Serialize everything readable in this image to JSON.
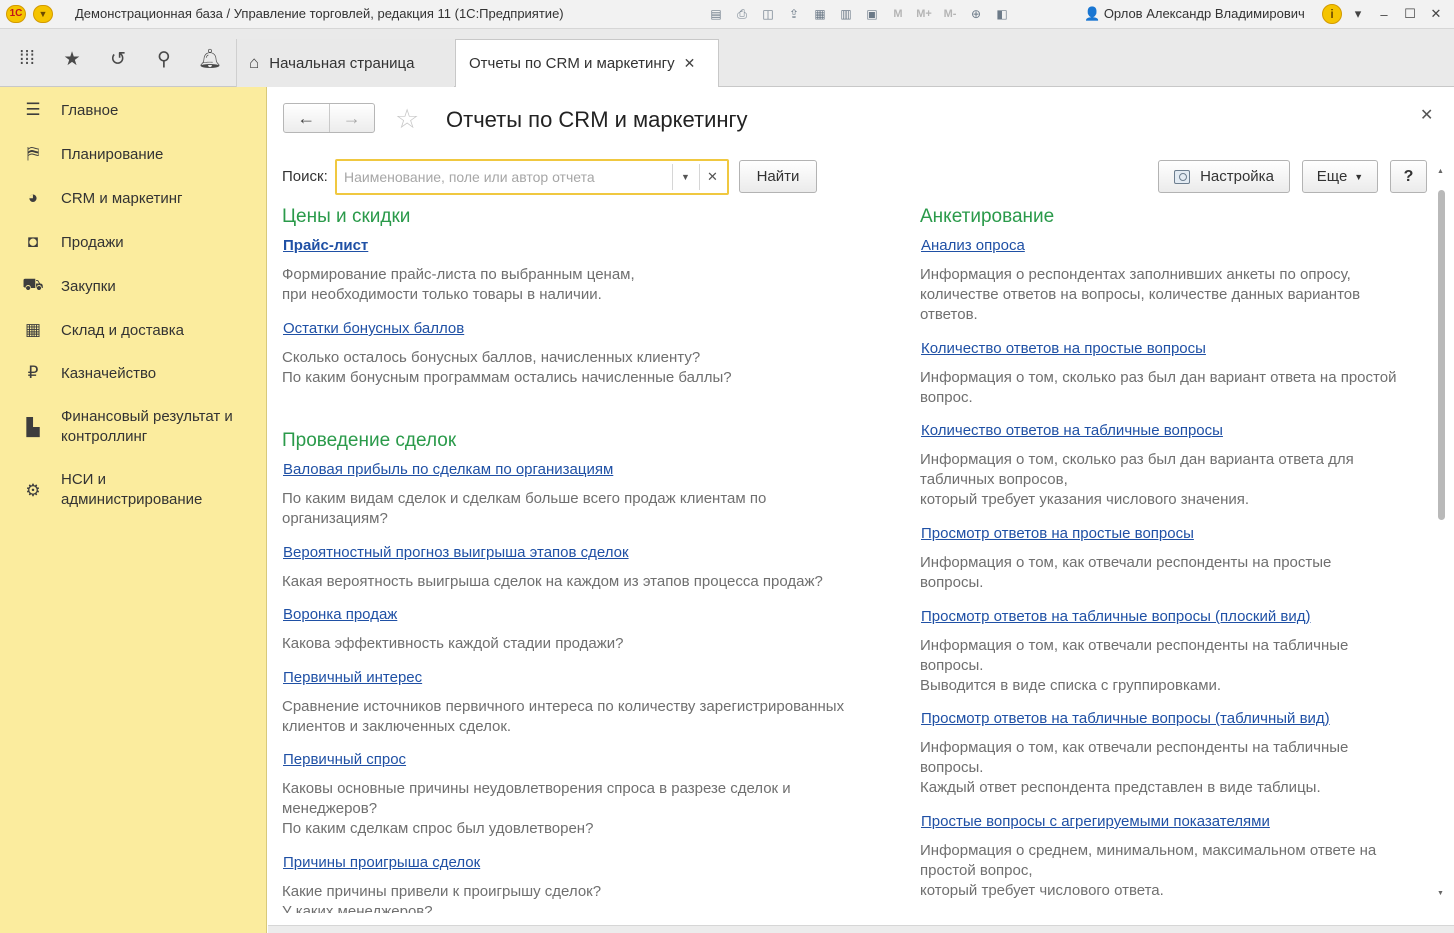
{
  "titlebar": {
    "logo": "1С",
    "title": "Демонстрационная база / Управление торговлей, редакция 11  (1С:Предприятие)",
    "user": "Орлов Александр Владимирович",
    "mem_labels": [
      "M",
      "M+",
      "M-"
    ]
  },
  "tabs": {
    "home": "Начальная страница",
    "active": "Отчеты по CRM и маркетингу"
  },
  "sidebar": {
    "items": [
      {
        "label": "Главное",
        "icon": "menu-icon"
      },
      {
        "label": "Планирование",
        "icon": "planning-icon"
      },
      {
        "label": "CRM и маркетинг",
        "icon": "pie-chart-icon"
      },
      {
        "label": "Продажи",
        "icon": "shopping-bag-icon"
      },
      {
        "label": "Закупки",
        "icon": "cart-icon"
      },
      {
        "label": "Склад и доставка",
        "icon": "warehouse-icon"
      },
      {
        "label": "Казначейство",
        "icon": "ruble-icon"
      },
      {
        "label": "Финансовый результат и контроллинг",
        "icon": "bar-chart-icon"
      },
      {
        "label": "НСИ и администрирование",
        "icon": "gear-icon"
      }
    ]
  },
  "page": {
    "title": "Отчеты по CRM и маркетингу",
    "search_label": "Поиск:",
    "search_placeholder": "Наименование, поле или автор отчета",
    "find_button": "Найти",
    "setup_button": "Настройка",
    "more_button": "Еще",
    "help_button": "?"
  },
  "left": {
    "sections": [
      {
        "title": "Цены и скидки",
        "reports": [
          {
            "name": "Прайс-лист",
            "desc": "Формирование прайс-листа по выбранным ценам,\nпри необходимости только товары в наличии."
          },
          {
            "name": "Остатки бонусных баллов",
            "desc": "Сколько осталось бонусных баллов, начисленных клиенту?\nПо каким бонусным программам остались начисленные баллы?"
          }
        ]
      },
      {
        "title": "Проведение сделок",
        "reports": [
          {
            "name": "Валовая прибыль по сделкам по организациям",
            "desc": "По каким видам сделок и сделкам больше всего продаж клиентам по\nорганизациям?"
          },
          {
            "name": "Вероятностный прогноз выигрыша этапов сделок",
            "desc": "Какая вероятность выигрыша сделок на каждом из этапов процесса продаж?"
          },
          {
            "name": "Воронка продаж",
            "desc": "Какова эффективность каждой стадии продажи?"
          },
          {
            "name": "Первичный интерес",
            "desc": "Сравнение источников первичного интереса по количеству зарегистрированных\nклиентов и заключенных сделок."
          },
          {
            "name": "Первичный спрос",
            "desc": "Каковы основные причины неудовлетворения спроса в разрезе сделок и\nменеджеров?\nПо каким сделкам спрос был удовлетворен?"
          },
          {
            "name": "Причины проигрыша сделок",
            "desc": "Какие причины привели к проигрышу сделок?\nУ каких менеджеров?"
          }
        ]
      }
    ]
  },
  "right": {
    "sections": [
      {
        "title": "Анкетирование",
        "reports": [
          {
            "name": "Анализ опроса",
            "desc": "Информация о респондентах заполнивших анкеты по опросу,\nколичестве ответов на вопросы, количестве данных вариантов\nответов."
          },
          {
            "name": "Количество ответов на простые вопросы",
            "desc": "Информация о том, сколько раз был дан вариант ответа на простой\nвопрос."
          },
          {
            "name": "Количество ответов на табличные вопросы",
            "desc": "Информация о том, сколько раз был дан варианта ответа для\nтабличных вопросов,\nкоторый требует указания числового значения."
          },
          {
            "name": "Просмотр ответов на простые вопросы",
            "desc": "Информация о том, как отвечали респонденты на простые\nвопросы."
          },
          {
            "name": "Просмотр ответов на табличные вопросы (плоский вид)",
            "desc": "Информация о том, как отвечали респонденты на табличные\nвопросы.\nВыводится в виде списка с группировками."
          },
          {
            "name": "Просмотр ответов на табличные вопросы (табличный вид)",
            "desc": "Информация о том, как  отвечали респонденты на табличные\nвопросы.\nКаждый ответ респондента представлен в виде таблицы."
          },
          {
            "name": "Простые вопросы с агрегируемыми показателями",
            "desc": "Информация о среднем, минимальном, максимальном ответе на\nпростой вопрос,\nкоторый требует числового ответа."
          }
        ]
      }
    ]
  }
}
